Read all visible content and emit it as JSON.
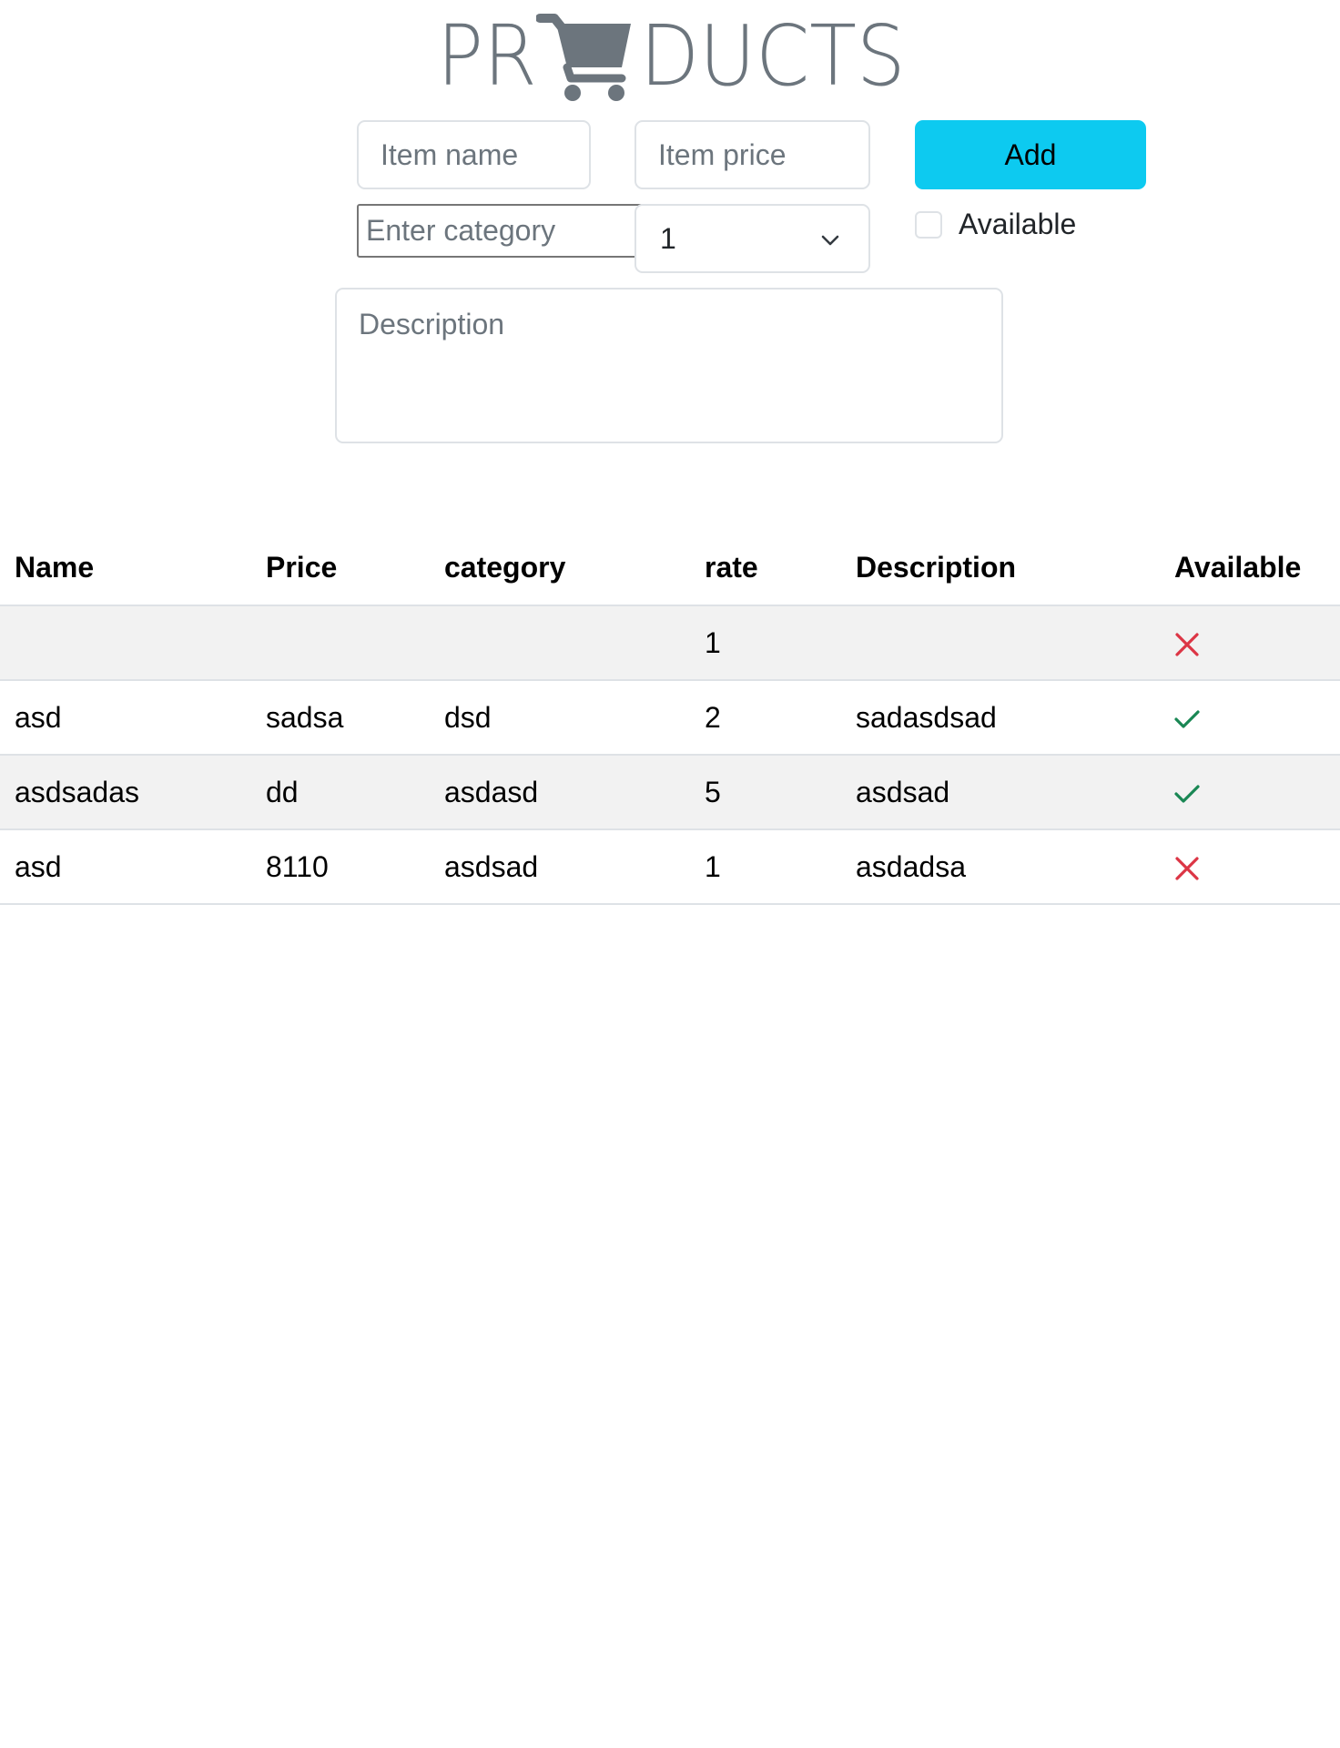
{
  "title": {
    "prefix": "PR",
    "suffix": "DUCTS",
    "logo_icon": "shopping-cart-icon",
    "color": "#6c757d"
  },
  "form": {
    "item_name_placeholder": "Item name",
    "item_price_placeholder": "Item price",
    "category_placeholder": "Enter category",
    "rate_selected": "1",
    "add_label": "Add",
    "available_label": "Available",
    "description_placeholder": "Description",
    "add_button_color": "#0dcaf0"
  },
  "table": {
    "headers": [
      "Name",
      "Price",
      "category",
      "rate",
      "Description",
      "Available"
    ],
    "rows": [
      {
        "name": "",
        "price": "",
        "category": "",
        "rate": "1",
        "description": "",
        "available": false
      },
      {
        "name": "asd",
        "price": "sadsa",
        "category": "dsd",
        "rate": "2",
        "description": "sadasdsad",
        "available": true
      },
      {
        "name": "asdsadas",
        "price": "dd",
        "category": "asdasd",
        "rate": "5",
        "description": "asdsad",
        "available": true
      },
      {
        "name": "asd",
        "price": "8110",
        "category": "asdsad",
        "rate": "1",
        "description": "asdadsa",
        "available": false
      }
    ],
    "available_true_icon": "check-icon",
    "available_false_icon": "x-icon",
    "check_color": "#198754",
    "x_color": "#dc3545"
  }
}
